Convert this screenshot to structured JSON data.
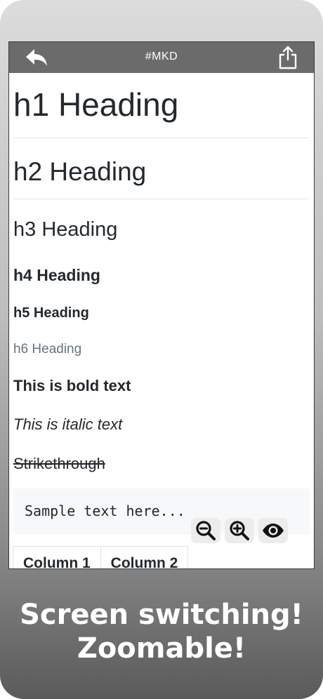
{
  "navbar": {
    "title": "#MKD",
    "back_icon": "reply-arrow-icon",
    "share_icon": "share-icon"
  },
  "document": {
    "h1": "h1 Heading",
    "h2": "h2 Heading",
    "h3": "h3 Heading",
    "h4": "h4 Heading",
    "h5": "h5 Heading",
    "h6": "h6 Heading",
    "bold": "This is bold text",
    "italic": "This is italic text",
    "strikethrough": "Strikethrough",
    "code": "Sample text here...",
    "table": {
      "headers": [
        "Column 1",
        "Column 2"
      ]
    }
  },
  "zoom_controls": {
    "zoom_out_icon": "zoom-out-icon",
    "zoom_in_icon": "zoom-in-icon",
    "preview_icon": "eye-icon"
  },
  "caption": {
    "line1": "Screen switching!",
    "line2": "Zoomable!"
  },
  "colors": {
    "navbar": "#6b6b6b",
    "frame_top": "#dcdcdc",
    "frame_bottom": "#5a5a5a"
  }
}
